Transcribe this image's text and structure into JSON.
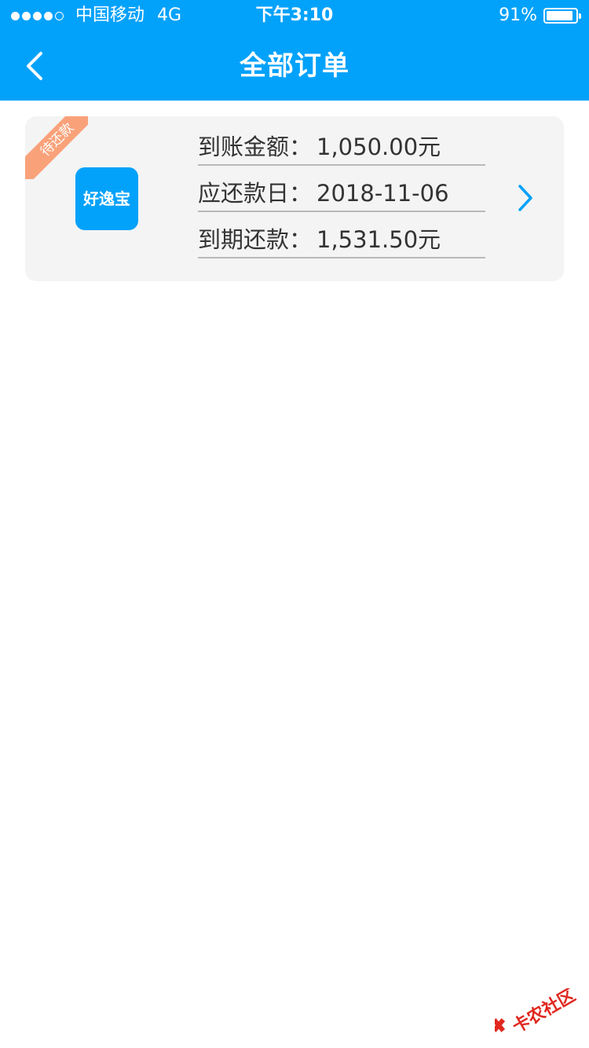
{
  "status_bar": {
    "carrier": "中国移动",
    "network": "4G",
    "time": "下午3:10",
    "battery": "91%",
    "battery_level": 0.91
  },
  "nav": {
    "title": "全部订单",
    "back_icon": "chevron-left-icon"
  },
  "orders": [
    {
      "status_tag": "待还款",
      "app_logo_text": "好逸宝",
      "fields": [
        {
          "label": "到账金额：",
          "value": "1,050.00元"
        },
        {
          "label": "应还款日：",
          "value": "2018-11-06"
        },
        {
          "label": "到期还款：",
          "value": "1,531.50元"
        }
      ],
      "detail_icon": "chevron-right-icon"
    }
  ],
  "watermark": {
    "text": "卡农社区"
  },
  "colors": {
    "primary": "#03a2fa",
    "tag": "#f9a27a",
    "card_bg": "#f4f4f4"
  }
}
